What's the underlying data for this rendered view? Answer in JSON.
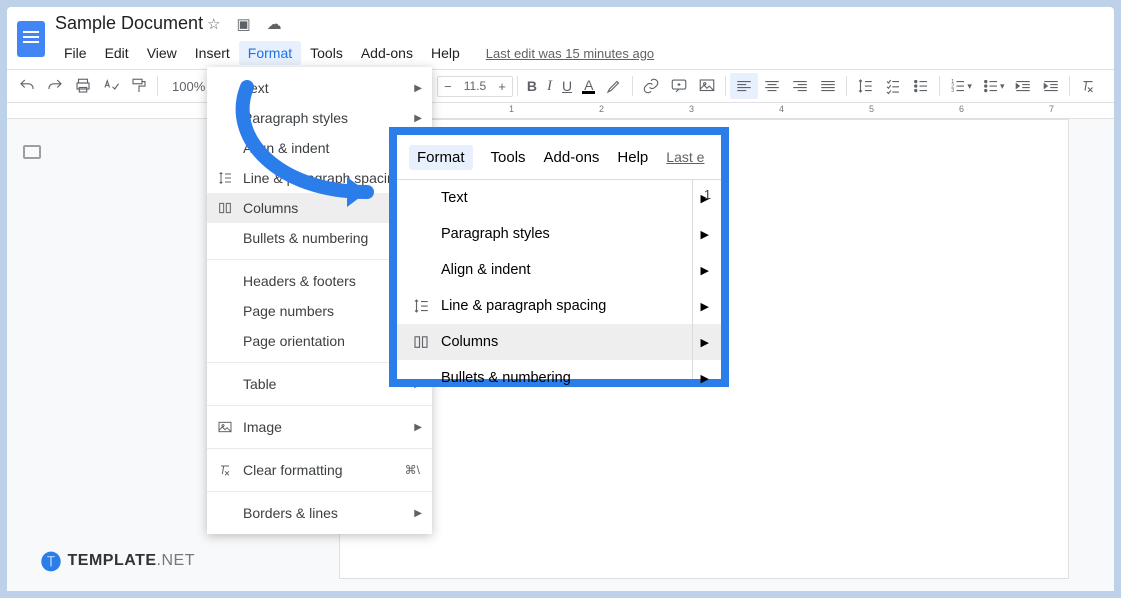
{
  "header": {
    "doc_title": "Sample Document",
    "last_edit": "Last edit was 15 minutes ago"
  },
  "menubar": [
    "File",
    "Edit",
    "View",
    "Insert",
    "Format",
    "Tools",
    "Add-ons",
    "Help"
  ],
  "toolbar": {
    "zoom": "100%",
    "font_size": "11.5"
  },
  "ruler_labels": [
    "1",
    "2",
    "3",
    "4",
    "5",
    "6",
    "7"
  ],
  "format_menu": {
    "items": [
      {
        "label": "Text",
        "arrow": true
      },
      {
        "label": "Paragraph styles",
        "arrow": true
      },
      {
        "label": "Align & indent",
        "arrow": true
      },
      {
        "label": "Line & paragraph spacing",
        "arrow": true,
        "icon": "line-spacing"
      },
      {
        "label": "Columns",
        "arrow": true,
        "icon": "columns",
        "hl": true
      },
      {
        "label": "Bullets & numbering",
        "arrow": true
      }
    ],
    "group2": [
      {
        "label": "Headers & footers"
      },
      {
        "label": "Page numbers"
      },
      {
        "label": "Page orientation"
      }
    ],
    "group3": [
      {
        "label": "Table",
        "arrow": true
      }
    ],
    "group4": [
      {
        "label": "Image",
        "arrow": true,
        "icon": "image"
      }
    ],
    "group5": [
      {
        "label": "Clear formatting",
        "shortcut": "⌘\\",
        "icon": "clear"
      }
    ],
    "group6": [
      {
        "label": "Borders & lines",
        "arrow": true
      }
    ]
  },
  "callout": {
    "menubar": [
      "Format",
      "Tools",
      "Add-ons",
      "Help"
    ],
    "last_edit_trunc": "Last e",
    "rside": "1",
    "items": [
      {
        "label": "Text",
        "arrow": true
      },
      {
        "label": "Paragraph styles",
        "arrow": true
      },
      {
        "label": "Align & indent",
        "arrow": true
      },
      {
        "label": "Line & paragraph spacing",
        "arrow": true,
        "icon": "line-spacing"
      },
      {
        "label": "Columns",
        "arrow": true,
        "icon": "columns",
        "hl": true
      },
      {
        "label": "Bullets & numbering",
        "arrow": true
      }
    ]
  },
  "watermark": {
    "brand": "TEMPLATE",
    "suffix": ".NET"
  }
}
